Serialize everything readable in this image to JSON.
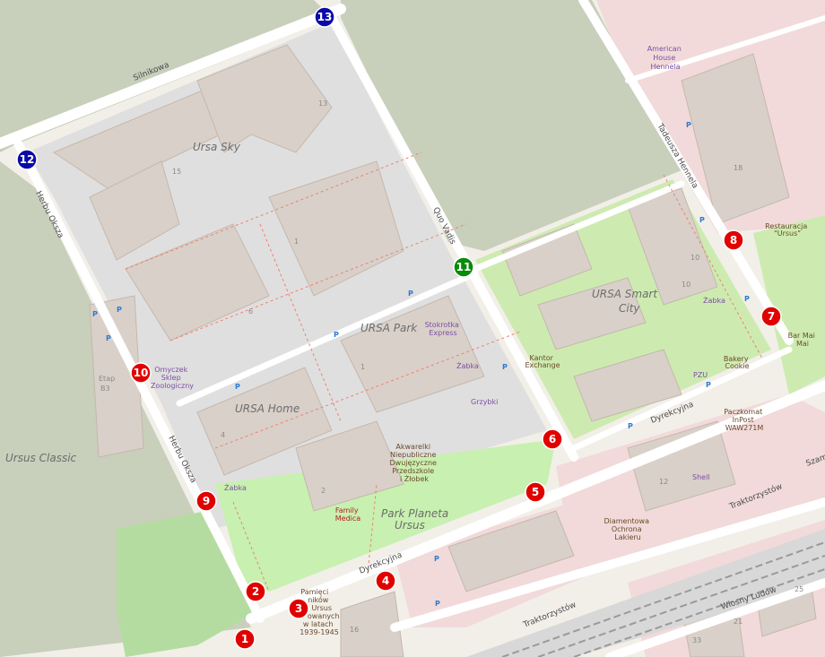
{
  "area_labels": {
    "ursa_sky": "Ursa Sky",
    "ursa_park": "URSA Park",
    "ursa_home": "URSA Home",
    "ursa_smart_city_1": "URSA Smart",
    "ursa_smart_city_2": "City",
    "ursus_classic": "Ursus Classic",
    "park_planeta_1": "Park Planeta",
    "park_planeta_2": "Ursus",
    "etap_1": "Etap",
    "etap_2": "B3"
  },
  "streets": {
    "silnikowa": "Silnikowa",
    "herbu_oksza_top": "Herbu Oksza",
    "herbu_oksza_bottom": "Herbu Oksza",
    "quo_vadis": "Quo Vadis",
    "tadeusza_hennela": "Tadeusza Hennela",
    "dyrekcyjna_left": "Dyrekcyjna",
    "dyrekcyjna_right": "Dyrekcyjna",
    "traktorzystow_1": "Traktorzystów",
    "traktorzystow_2": "Traktorzystów",
    "wiosny_ludow": "Wiosny Ludów",
    "szam": "Szam"
  },
  "pois": {
    "american_house": [
      "American",
      "House",
      "Hennela"
    ],
    "restauracja": [
      "Restauracja",
      "\"Ursus\""
    ],
    "bar_mai_mai": [
      "Bar Mai",
      "Mai"
    ],
    "zabka_right": "Żabka",
    "bakery": [
      "Bakery",
      "Cookie"
    ],
    "kantor": [
      "Kantor",
      "Exchange"
    ],
    "stokrotka": [
      "Stokrotka",
      "Express"
    ],
    "zabka_mid": "Żabka",
    "grzybki": "Grzybki",
    "pzu": "PZU",
    "paczkomat": [
      "Paczkomat",
      "InPost",
      "WAW271M"
    ],
    "shell": "Shell",
    "diamentowa": [
      "Diamentowa",
      "Ochrona",
      "Lakieru"
    ],
    "akwarelki": [
      "Akwarelki",
      "Niepubliczne",
      "Dwujęzyczne",
      "Przedszkole",
      "i Żłobek"
    ],
    "family_medica": [
      "Family",
      "Medica"
    ],
    "zabka_left": "Żabka",
    "omyczek": [
      "Omyczek",
      "Sklep",
      "Zoologiczny"
    ],
    "pamieci": [
      "Pamięci",
      "ników",
      "Ursus",
      "owanych",
      "w latach",
      "1939-1945"
    ]
  },
  "building_numbers": {
    "b13": "13",
    "b15": "15",
    "b1a": "1",
    "b6": "6",
    "b1b": "1",
    "b4": "4",
    "b2": "2",
    "b10a": "10",
    "b10b": "10",
    "b18": "18",
    "b12": "12",
    "b16": "16",
    "b21": "21",
    "b25": "25",
    "b33": "33"
  },
  "markers": [
    {
      "id": "1",
      "color": "#e00000"
    },
    {
      "id": "2",
      "color": "#e00000"
    },
    {
      "id": "3",
      "color": "#e00000"
    },
    {
      "id": "4",
      "color": "#e00000"
    },
    {
      "id": "5",
      "color": "#e00000"
    },
    {
      "id": "6",
      "color": "#e00000"
    },
    {
      "id": "7",
      "color": "#e00000"
    },
    {
      "id": "8",
      "color": "#e00000"
    },
    {
      "id": "9",
      "color": "#e00000"
    },
    {
      "id": "10",
      "color": "#e00000"
    },
    {
      "id": "11",
      "color": "#0a8a0a"
    },
    {
      "id": "12",
      "color": "#0a0aa8"
    },
    {
      "id": "13",
      "color": "#0a0aa8"
    }
  ],
  "colors": {
    "land": "#f2efe9",
    "residential": "#e0dfdf",
    "farmland": "#c8cfbb",
    "park": "#c8f0b0",
    "grass": "#cdebb0",
    "building": "#d9d0c9",
    "commercial": "#f2dada",
    "road": "#ffffff",
    "rail": "#9a9a9a",
    "marker_red": "#e00000",
    "marker_green": "#0a8a0a",
    "marker_blue": "#0a0aa8"
  }
}
